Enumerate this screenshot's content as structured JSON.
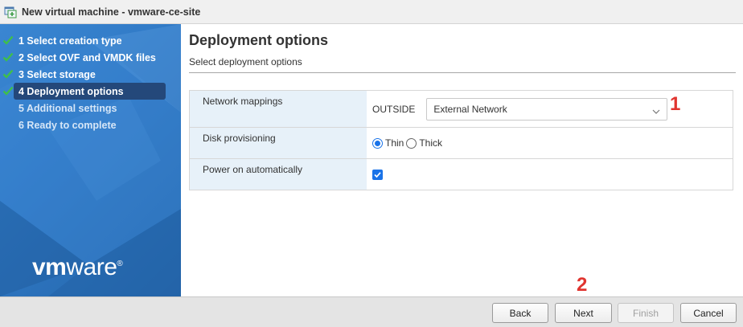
{
  "window": {
    "title": "New virtual machine - vmware-ce-site"
  },
  "sidebar": {
    "steps": [
      {
        "label": "1 Select creation type",
        "state": "done"
      },
      {
        "label": "2 Select OVF and VMDK files",
        "state": "done"
      },
      {
        "label": "3 Select storage",
        "state": "done"
      },
      {
        "label": "4 Deployment options",
        "state": "active"
      },
      {
        "label": "5 Additional settings",
        "state": "pending"
      },
      {
        "label": "6 Ready to complete",
        "state": "pending"
      }
    ],
    "logo": {
      "vm": "vm",
      "ware": "ware",
      "reg": "®"
    }
  },
  "main": {
    "title": "Deployment options",
    "subtitle": "Select deployment options",
    "rows": {
      "network": {
        "label": "Network mappings",
        "key": "OUTSIDE",
        "selected": "External Network"
      },
      "disk": {
        "label": "Disk provisioning",
        "options": [
          "Thin",
          "Thick"
        ],
        "selected": "Thin"
      },
      "power": {
        "label": "Power on automatically",
        "checked": true
      }
    }
  },
  "annotations": {
    "one": "1",
    "two": "2"
  },
  "footer": {
    "back": "Back",
    "next": "Next",
    "finish": "Finish",
    "cancel": "Cancel"
  },
  "colors": {
    "sidebar": "#2e77c3",
    "active_step": "#24487a",
    "accent": "#1a73e8",
    "annotation": "#e0342f"
  },
  "icons": {
    "window": "vm-window-icon",
    "check": "check-icon",
    "chevron": "chevron-down-icon"
  }
}
